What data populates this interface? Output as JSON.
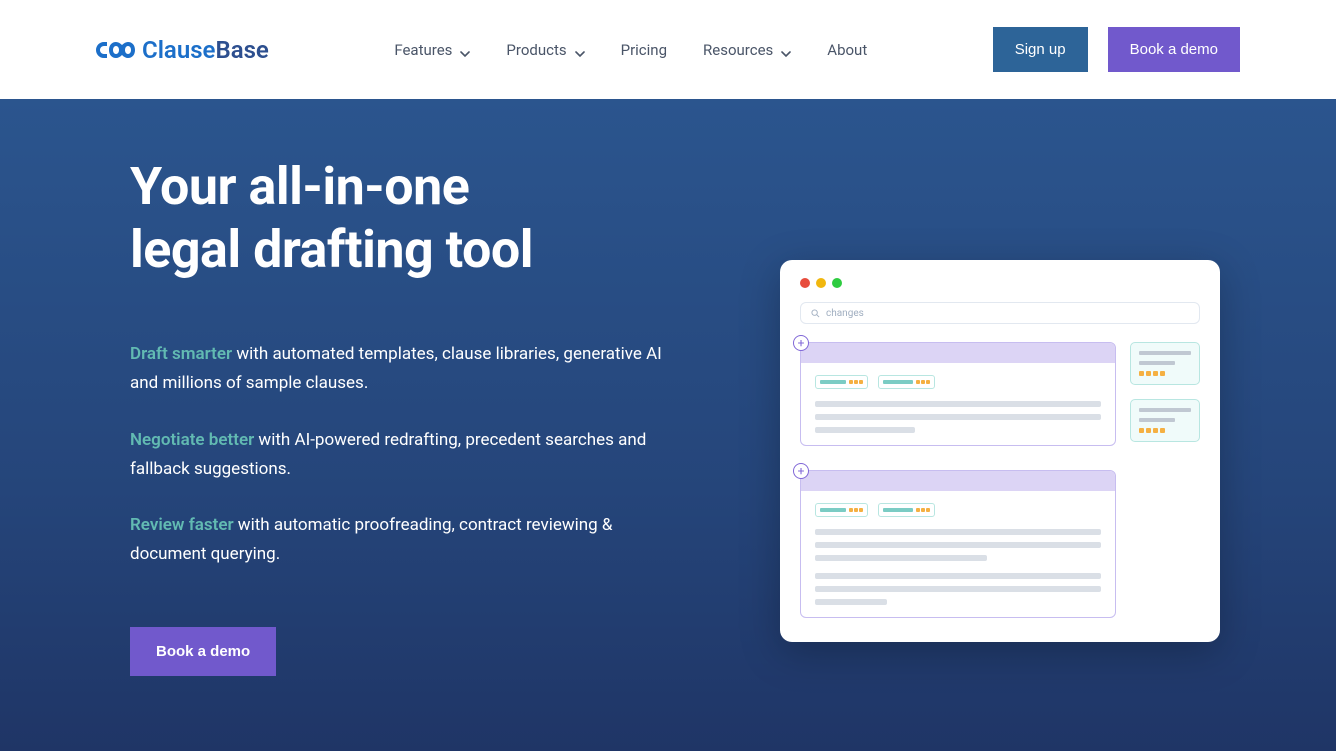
{
  "brand": {
    "name1": "Clause",
    "name2": "Base"
  },
  "nav": {
    "features": "Features",
    "products": "Products",
    "pricing": "Pricing",
    "resources": "Resources",
    "about": "About"
  },
  "actions": {
    "signup": "Sign up",
    "demo": "Book a demo"
  },
  "hero": {
    "title_line1": "Your all-in-one",
    "title_line2": "legal drafting tool",
    "blocks": [
      {
        "lead": "Draft smarter",
        "rest": " with automated templates, clause libraries, generative AI and millions of sample clauses."
      },
      {
        "lead": "Negotiate better",
        "rest": " with AI-powered redrafting, precedent searches and fallback suggestions."
      },
      {
        "lead": "Review faster",
        "rest": " with automatic proofreading, contract reviewing & document querying."
      }
    ],
    "cta": "Book a demo"
  },
  "illustration": {
    "search_placeholder": "changes"
  }
}
